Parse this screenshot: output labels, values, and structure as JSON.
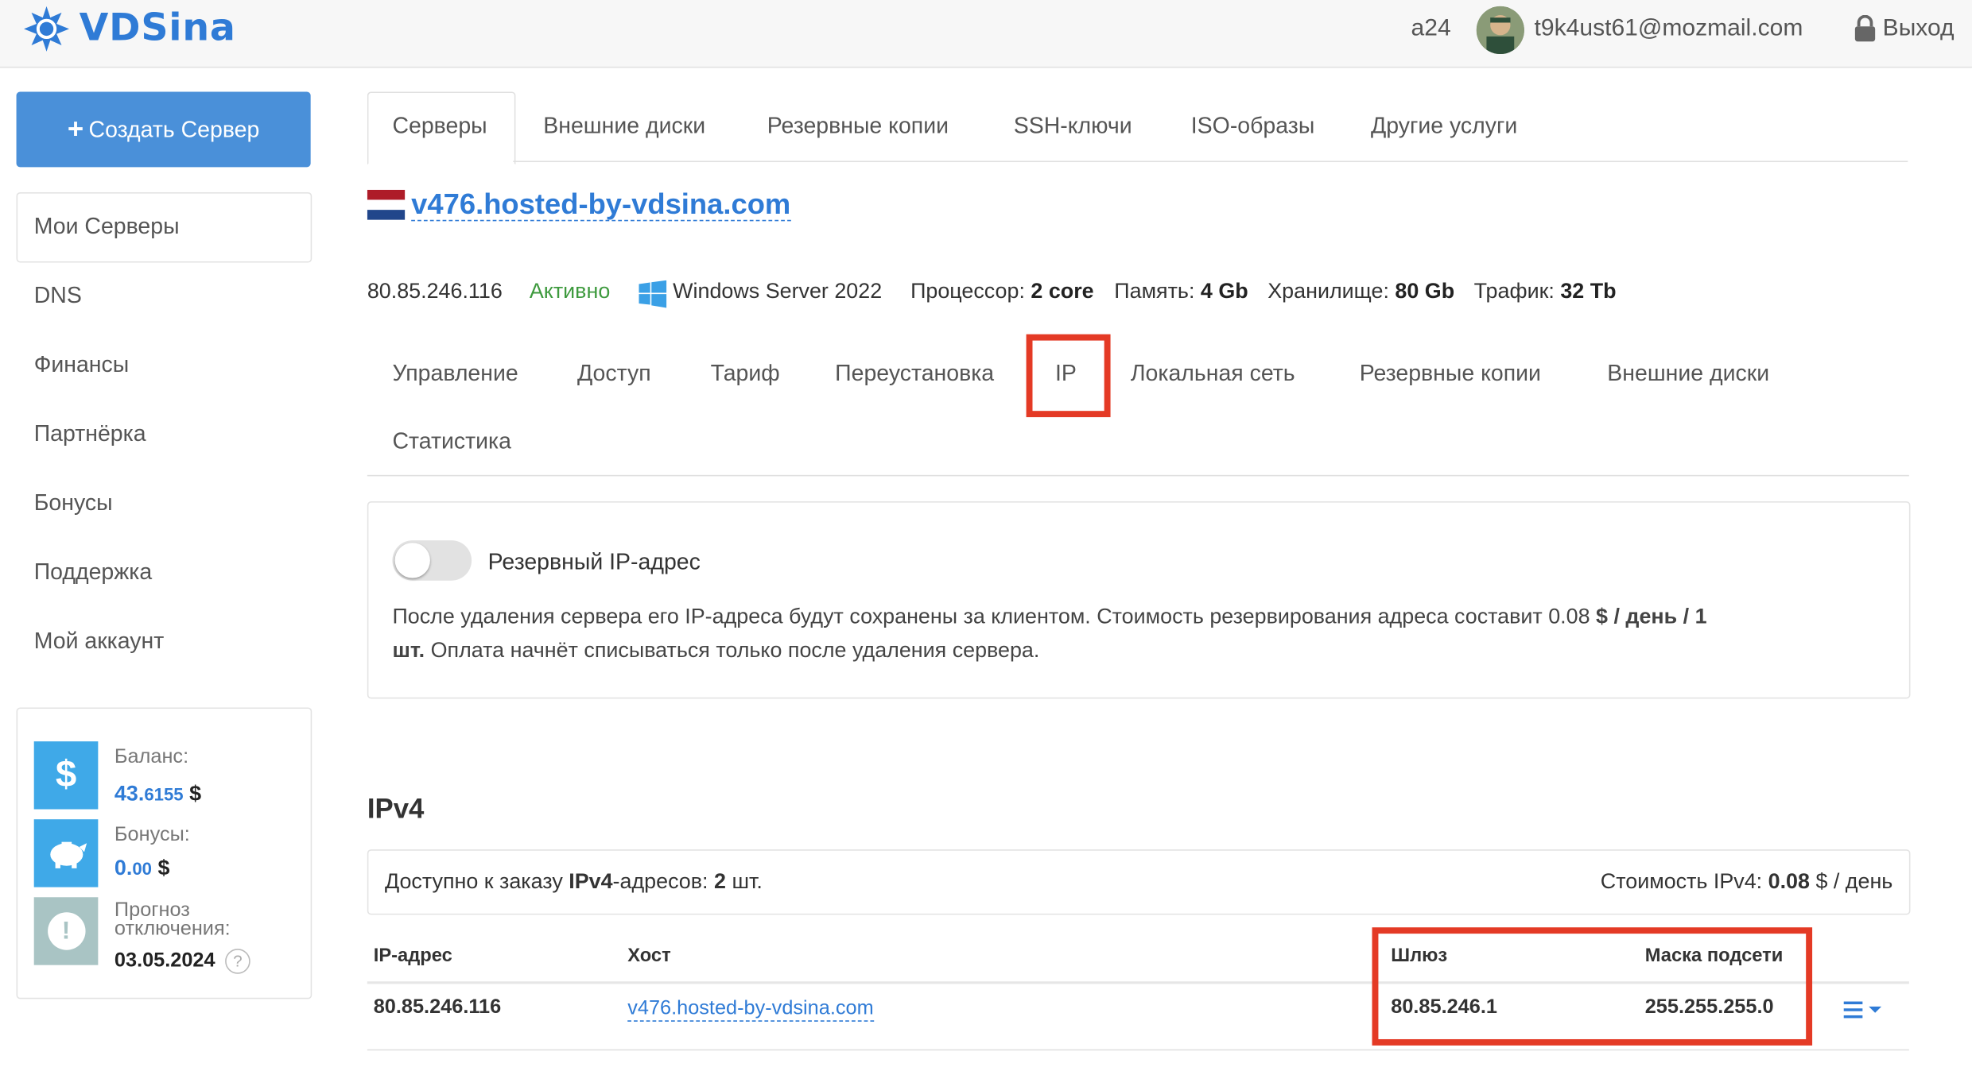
{
  "header": {
    "logo": "VDSina",
    "user_id": "a24",
    "email": "t9k4ust61@mozmail.com",
    "logout": "Выход"
  },
  "sidebar": {
    "create_button": "Создать Сервер",
    "items": [
      {
        "label": "Мои Серверы"
      },
      {
        "label": "DNS"
      },
      {
        "label": "Финансы"
      },
      {
        "label": "Партнёрка"
      },
      {
        "label": "Бонусы"
      },
      {
        "label": "Поддержка"
      },
      {
        "label": "Мой аккаунт"
      }
    ],
    "balance": {
      "balance_label": "Баланс:",
      "balance_int": "43.",
      "balance_frac": "6155",
      "balance_cur": "$",
      "bonus_label": "Бонусы:",
      "bonus_int": "0.",
      "bonus_frac": "00",
      "bonus_cur": "$",
      "forecast_label_1": "Прогноз",
      "forecast_label_2": "отключения:",
      "forecast_date": "03.05.2024",
      "help_icon_glyph": "?"
    }
  },
  "tabs": [
    {
      "label": "Серверы"
    },
    {
      "label": "Внешние диски"
    },
    {
      "label": "Резервные копии"
    },
    {
      "label": "SSH-ключи"
    },
    {
      "label": "ISO-образы"
    },
    {
      "label": "Другие услуги"
    }
  ],
  "server": {
    "hostname": "v476.hosted-by-vdsina.com",
    "ip": "80.85.246.116",
    "status": "Активно",
    "os": "Windows Server 2022",
    "cpu_label": "Процессор:",
    "cpu_value": "2 core",
    "mem_label": "Память:",
    "mem_value": "4 Gb",
    "storage_label": "Хранилище:",
    "storage_value": "80 Gb",
    "traffic_label": "Трафик:",
    "traffic_value": "32 Tb"
  },
  "subtabs": [
    {
      "label": "Управление"
    },
    {
      "label": "Доступ"
    },
    {
      "label": "Тариф"
    },
    {
      "label": "Переустановка"
    },
    {
      "label": "IP"
    },
    {
      "label": "Локальная сеть"
    },
    {
      "label": "Резервные копии"
    },
    {
      "label": "Внешние диски"
    },
    {
      "label": "Статистика"
    }
  ],
  "reserve": {
    "toggle_label": "Резервный IP-адрес",
    "toggle_on": false,
    "desc_1": "После удаления сервера его IP-адреса будут сохранены за клиентом. Стоимость резервирования адреса составит 0.08 ",
    "desc_bold_1": "$ / день / 1",
    "desc_bold_2": "шт.",
    "desc_2": " Оплата начнёт списываться только после удаления сервера."
  },
  "ipv4": {
    "title": "IPv4",
    "avail_prefix": "Доступно к заказу ",
    "avail_bold": "IPv4",
    "avail_mid": "-адресов: ",
    "avail_count": "2",
    "avail_suffix": " шт.",
    "cost_prefix": "Стоимость IPv4: ",
    "cost_value": "0.08",
    "cost_suffix": " $ / день",
    "columns": [
      "IP-адрес",
      "Хост",
      "Шлюз",
      "Маска подсети"
    ],
    "rows": [
      {
        "ip": "80.85.246.116",
        "host": "v476.hosted-by-vdsina.com",
        "gateway": "80.85.246.1",
        "mask": "255.255.255.0"
      }
    ]
  },
  "colors": {
    "accent": "#4a90d9",
    "link": "#2f7bd6",
    "active_status": "#3e9a3e",
    "highlight": "#e43a25"
  }
}
